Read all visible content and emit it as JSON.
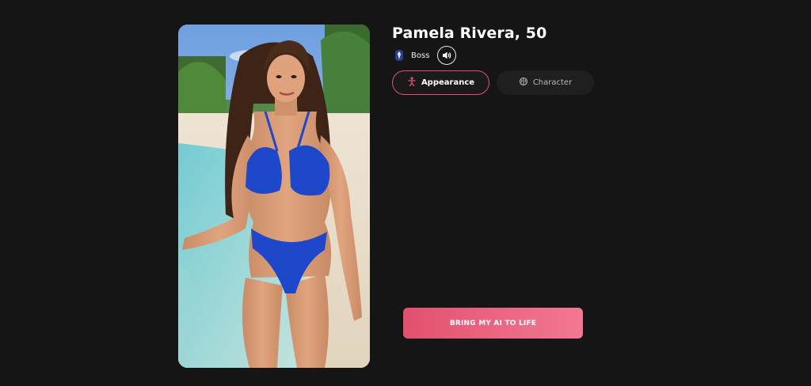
{
  "profile": {
    "title": "Pamela Rivera, 50",
    "role": "Boss",
    "photo_description": "person in blue bikini on tropical beach"
  },
  "tabs": [
    {
      "label": "Appearance",
      "icon": "person-icon",
      "active": true
    },
    {
      "label": "Character",
      "icon": "brain-icon",
      "active": false
    }
  ],
  "cta": {
    "label": "BRING MY AI TO LIFE"
  },
  "colors": {
    "background": "#151515",
    "accent": "#e2516f",
    "accent_end": "#f27893"
  }
}
